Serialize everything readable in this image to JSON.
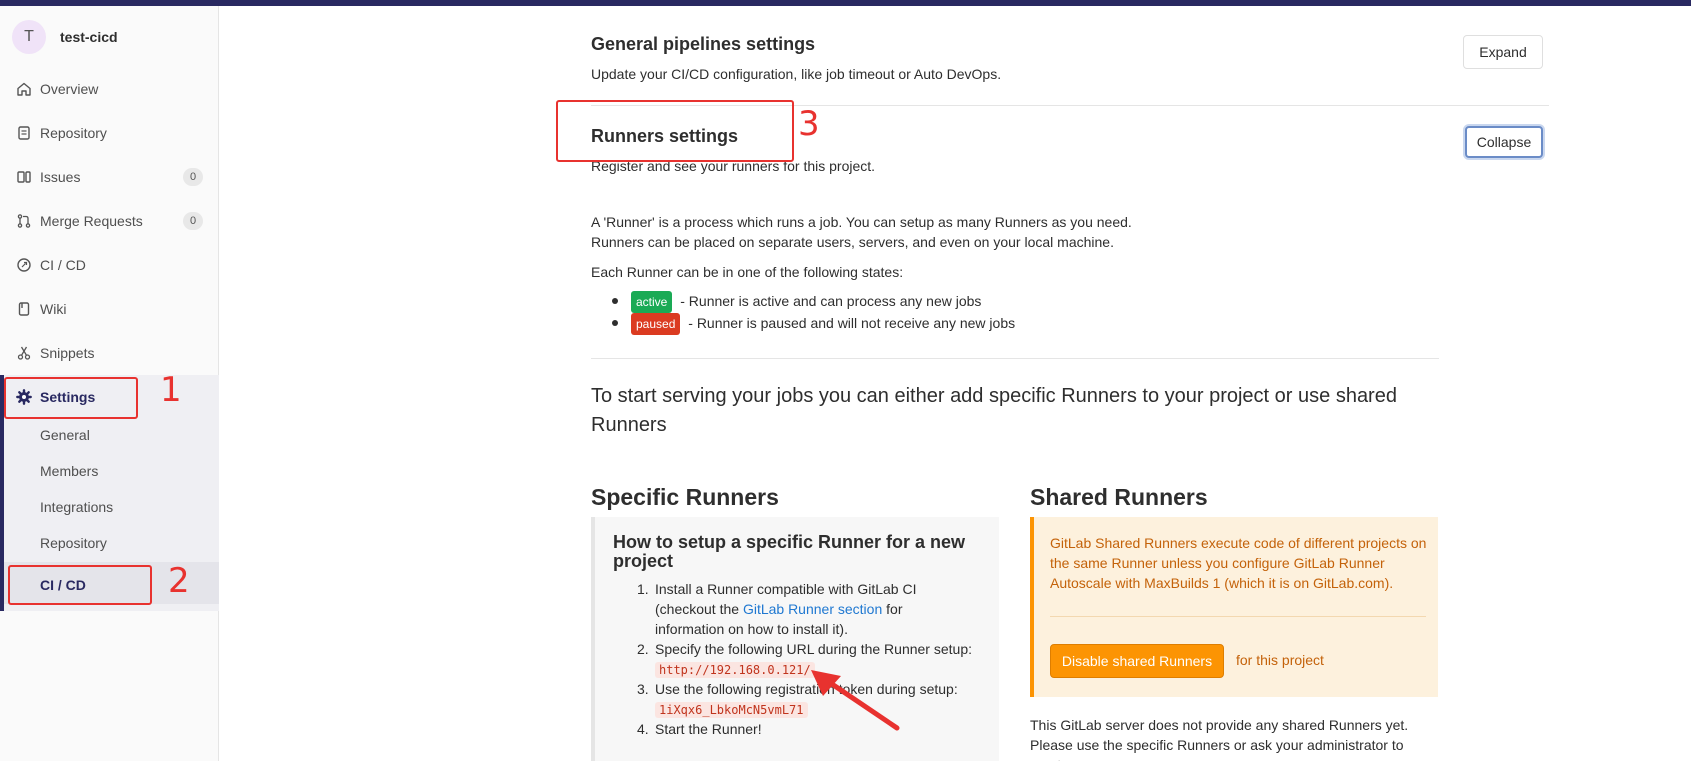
{
  "project": {
    "avatar_letter": "T",
    "name": "test-cicd"
  },
  "sidebar": {
    "items": [
      {
        "label": "Overview",
        "icon": "home-icon"
      },
      {
        "label": "Repository",
        "icon": "doc-icon"
      },
      {
        "label": "Issues",
        "icon": "issues-icon",
        "count": "0"
      },
      {
        "label": "Merge Requests",
        "icon": "merge-icon",
        "count": "0"
      },
      {
        "label": "CI / CD",
        "icon": "rocket-icon"
      },
      {
        "label": "Wiki",
        "icon": "book-icon"
      },
      {
        "label": "Snippets",
        "icon": "scissors-icon"
      },
      {
        "label": "Settings",
        "icon": "gear-icon"
      }
    ],
    "settings_sub": [
      "General",
      "Members",
      "Integrations",
      "Repository",
      "CI / CD"
    ]
  },
  "annotations": {
    "n1": "1",
    "n2": "2",
    "n3": "3"
  },
  "pipelines": {
    "title": "General pipelines settings",
    "desc": "Update your CI/CD configuration, like job timeout or Auto DevOps.",
    "button": "Expand"
  },
  "runners": {
    "title": "Runners settings",
    "desc": "Register and see your runners for this project.",
    "button": "Collapse",
    "intro_1": "A 'Runner' is a process which runs a job. You can setup as many Runners as you need.",
    "intro_2": "Runners can be placed on separate users, servers, and even on your local machine.",
    "states_intro": "Each Runner can be in one of the following states:",
    "state_active_badge": "active",
    "state_active_text": " - Runner is active and can process any new jobs",
    "state_paused_badge": "paused",
    "state_paused_text": " - Runner is paused and will not receive any new jobs",
    "lead": "To start serving your jobs you can either add specific Runners to your project or use shared Runners"
  },
  "specific": {
    "heading": "Specific Runners",
    "box_title": "How to setup a specific Runner for a new project",
    "step1_a": "Install a Runner compatible with GitLab CI",
    "step1_b": "(checkout the ",
    "step1_link": "GitLab Runner section",
    "step1_c": " for",
    "step1_d": "information on how to install it).",
    "step2": "Specify the following URL during the Runner setup:",
    "url": "http://192.168.0.121/",
    "step3": "Use the following registration token during setup:",
    "token": "1iXqx6_LbkoMcN5vmL71",
    "step4": "Start the Runner!"
  },
  "shared": {
    "heading": "Shared Runners",
    "warning": "GitLab Shared Runners execute code of different projects on the same Runner unless you configure GitLab Runner Autoscale with MaxBuilds 1 (which it is on GitLab.com).",
    "button": "Disable shared Runners",
    "after_button": "for this project",
    "note": "This GitLab server does not provide any shared Runners yet. Please use the specific Runners or ask your administrator to create one."
  }
}
